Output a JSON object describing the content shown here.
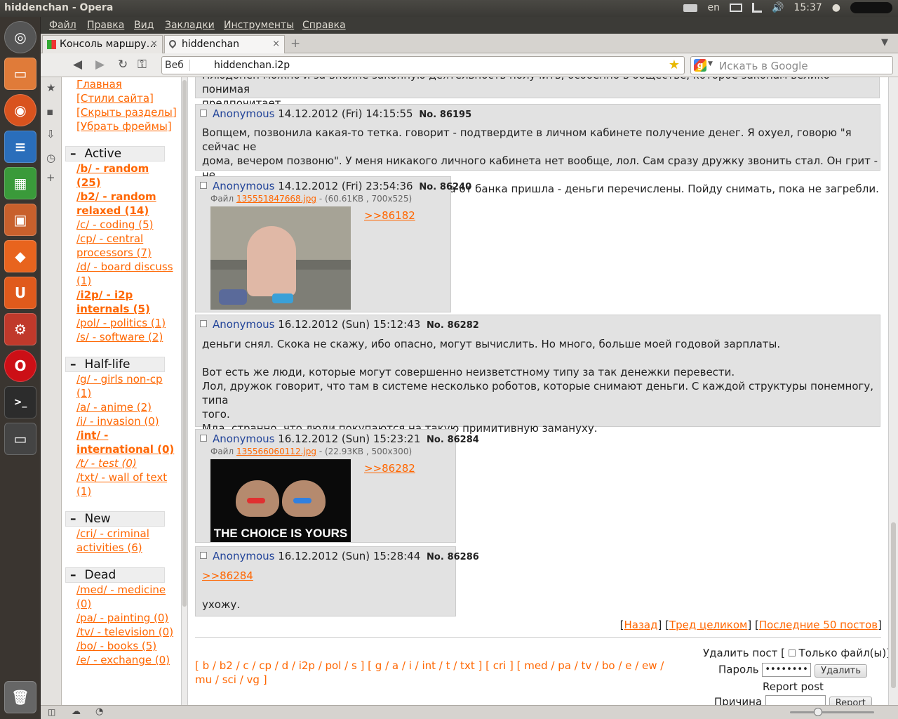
{
  "window": {
    "title": "hiddenchan - Opera"
  },
  "tray": {
    "lang": "en",
    "time": "15:37"
  },
  "menu": [
    "Файл",
    "Правка",
    "Вид",
    "Закладки",
    "Инструменты",
    "Справка"
  ],
  "tabs": [
    {
      "label": "Консоль маршру…",
      "close": "×"
    },
    {
      "label": "hiddenchan",
      "close": "×"
    }
  ],
  "address": {
    "web_label": "Веб",
    "url": "hiddenchan.i2p",
    "search_placeholder": "Искать в Google"
  },
  "sidebar": {
    "nav": [
      "Главная",
      "[Стили сайта]",
      "[Скрыть разделы]",
      "[Убрать фреймы]"
    ],
    "sections": [
      {
        "title": "Active",
        "toggle": "–",
        "items": [
          {
            "text": "/b/ - random (25)",
            "bold": true
          },
          {
            "text": "/b2/ - random relaxed (14)",
            "bold": true
          },
          {
            "text": "/c/ - coding (5)",
            "bold": false
          },
          {
            "text": "/cp/ - central processors (7)",
            "bold": false
          },
          {
            "text": "/d/ - board discuss (1)",
            "bold": false
          },
          {
            "text": "/i2p/ - i2p internals (5)",
            "bold": true
          },
          {
            "text": "/pol/ - politics (1)",
            "bold": false
          },
          {
            "text": "/s/ - software (2)",
            "bold": false
          }
        ]
      },
      {
        "title": "Half-life",
        "toggle": "–",
        "items": [
          {
            "text": "/g/ - girls non-cp (1)",
            "bold": false
          },
          {
            "text": "/a/ - anime (2)",
            "bold": false
          },
          {
            "text": "/i/ - invasion (0)",
            "bold": false
          },
          {
            "text": "/int/ - international (0)",
            "bold": true
          },
          {
            "text": "/t/ - test (0)",
            "bold": false
          },
          {
            "text": "/txt/ - wall of text (1)",
            "bold": false
          }
        ]
      },
      {
        "title": "New",
        "toggle": "–",
        "items": [
          {
            "text": "/cri/ - criminal activities (6)",
            "bold": false
          }
        ]
      },
      {
        "title": "Dead",
        "toggle": "–",
        "items": [
          {
            "text": "/med/ - medicine (0)",
            "bold": false
          },
          {
            "text": "/pa/ - painting (0)",
            "bold": false
          },
          {
            "text": "/tv/ - television (0)",
            "bold": false
          },
          {
            "text": "/bo/ - books (5)",
            "bold": false
          },
          {
            "text": "/e/ - exchange (0)",
            "bold": false
          }
        ]
      }
    ]
  },
  "top_fragment": "Плюдонен можно и за вполне законную деятельность получить, особенно в обществе, которое законам велико-понимая\nпредпочитает.",
  "posts": [
    {
      "name": "Anonymous",
      "date": "14.12.2012 (Fri) 14:15:55",
      "no_label": "No.",
      "no": "86195",
      "body": "Вопщем, позвонила какая-то тетка. говорит - подтвердите в личном кабинете получение денег. Я охуел, говорю \"я сейчас не\nдома, вечером позвоню\". У меня никакого личного кабинета нет вообще, лол. Сам сразу дружку звонить стал. Он грит - не\nссы, все сделано уже. А полчаса назад смска от банка пришла - деньги перечислены. Пойду снимать, пока не загребли."
    },
    {
      "name": "Anonymous",
      "date": "14.12.2012 (Fri) 23:54:36",
      "no_label": "No.",
      "no": "86240",
      "file_label": "Файл",
      "file_name": "135551847668.jpg",
      "file_meta": "- (60.61KB , 700x525)",
      "reply": ">>86182"
    },
    {
      "name": "Anonymous",
      "date": "16.12.2012 (Sun) 15:12:43",
      "no_label": "No.",
      "no": "86282",
      "body": "деньги снял. Скока не скажу, ибо опасно, могут вычислить. Но много, больше моей годовой зарплаты.\n\nВот есть же люди, которые могут совершенно неизветстному типу за так денежки перевести.\nЛол, дружок говорит, что там в системе несколько роботов, которые снимают деньги. С каждой структуры понемногу, типа\nтого.\nМда, странно, что люди покупаются на такую примитивную замануху."
    },
    {
      "name": "Anonymous",
      "date": "16.12.2012 (Sun) 15:23:21",
      "no_label": "No.",
      "no": "86284",
      "file_label": "Файл",
      "file_name": "135566060112.jpg",
      "file_meta": "- (22.93KB , 500x300)",
      "reply": ">>86282",
      "image_caption": "THE CHOICE IS YOURS"
    },
    {
      "name": "Anonymous",
      "date": "16.12.2012 (Sun) 15:28:44",
      "no_label": "No.",
      "no": "86286",
      "reply": ">>86284",
      "body": "ухожу."
    }
  ],
  "thread_nav": {
    "back": "Назад",
    "whole": "Тред целиком",
    "last50": "Последние 50 постов"
  },
  "board_list": "[ b / b2 / c / cp / d / i2p / pol / s ] [ g / a / i / int / t / txt ] [ cri ] [ med / pa / tv / bo / e / ew /\nmu / sci / vg ]",
  "delete_form": {
    "delete_label": "Удалить пост [",
    "only_file": "Только файл(ы)]",
    "password_label": "Пароль",
    "password_value": "••••••••",
    "delete_button": "Удалить",
    "report_label": "Report post",
    "reason_label": "Причина",
    "report_button": "Report"
  }
}
